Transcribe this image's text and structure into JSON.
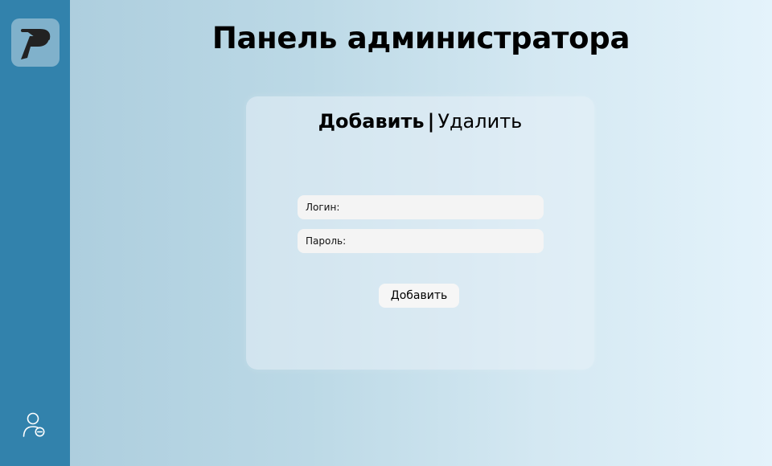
{
  "sidebar": {
    "logo_icon": "p-logo-icon",
    "logout_icon": "user-remove-icon",
    "background_color": "#3282ac"
  },
  "header": {
    "title": "Панель администратора"
  },
  "card": {
    "tabs": [
      {
        "label": "Добавить",
        "active": true
      },
      {
        "label": "Удалить",
        "active": false
      }
    ],
    "separator": "|",
    "fields": {
      "login": {
        "label": "Логин:",
        "value": ""
      },
      "password": {
        "label": "Пароль:",
        "value": ""
      }
    },
    "submit_label": "Добавить"
  }
}
